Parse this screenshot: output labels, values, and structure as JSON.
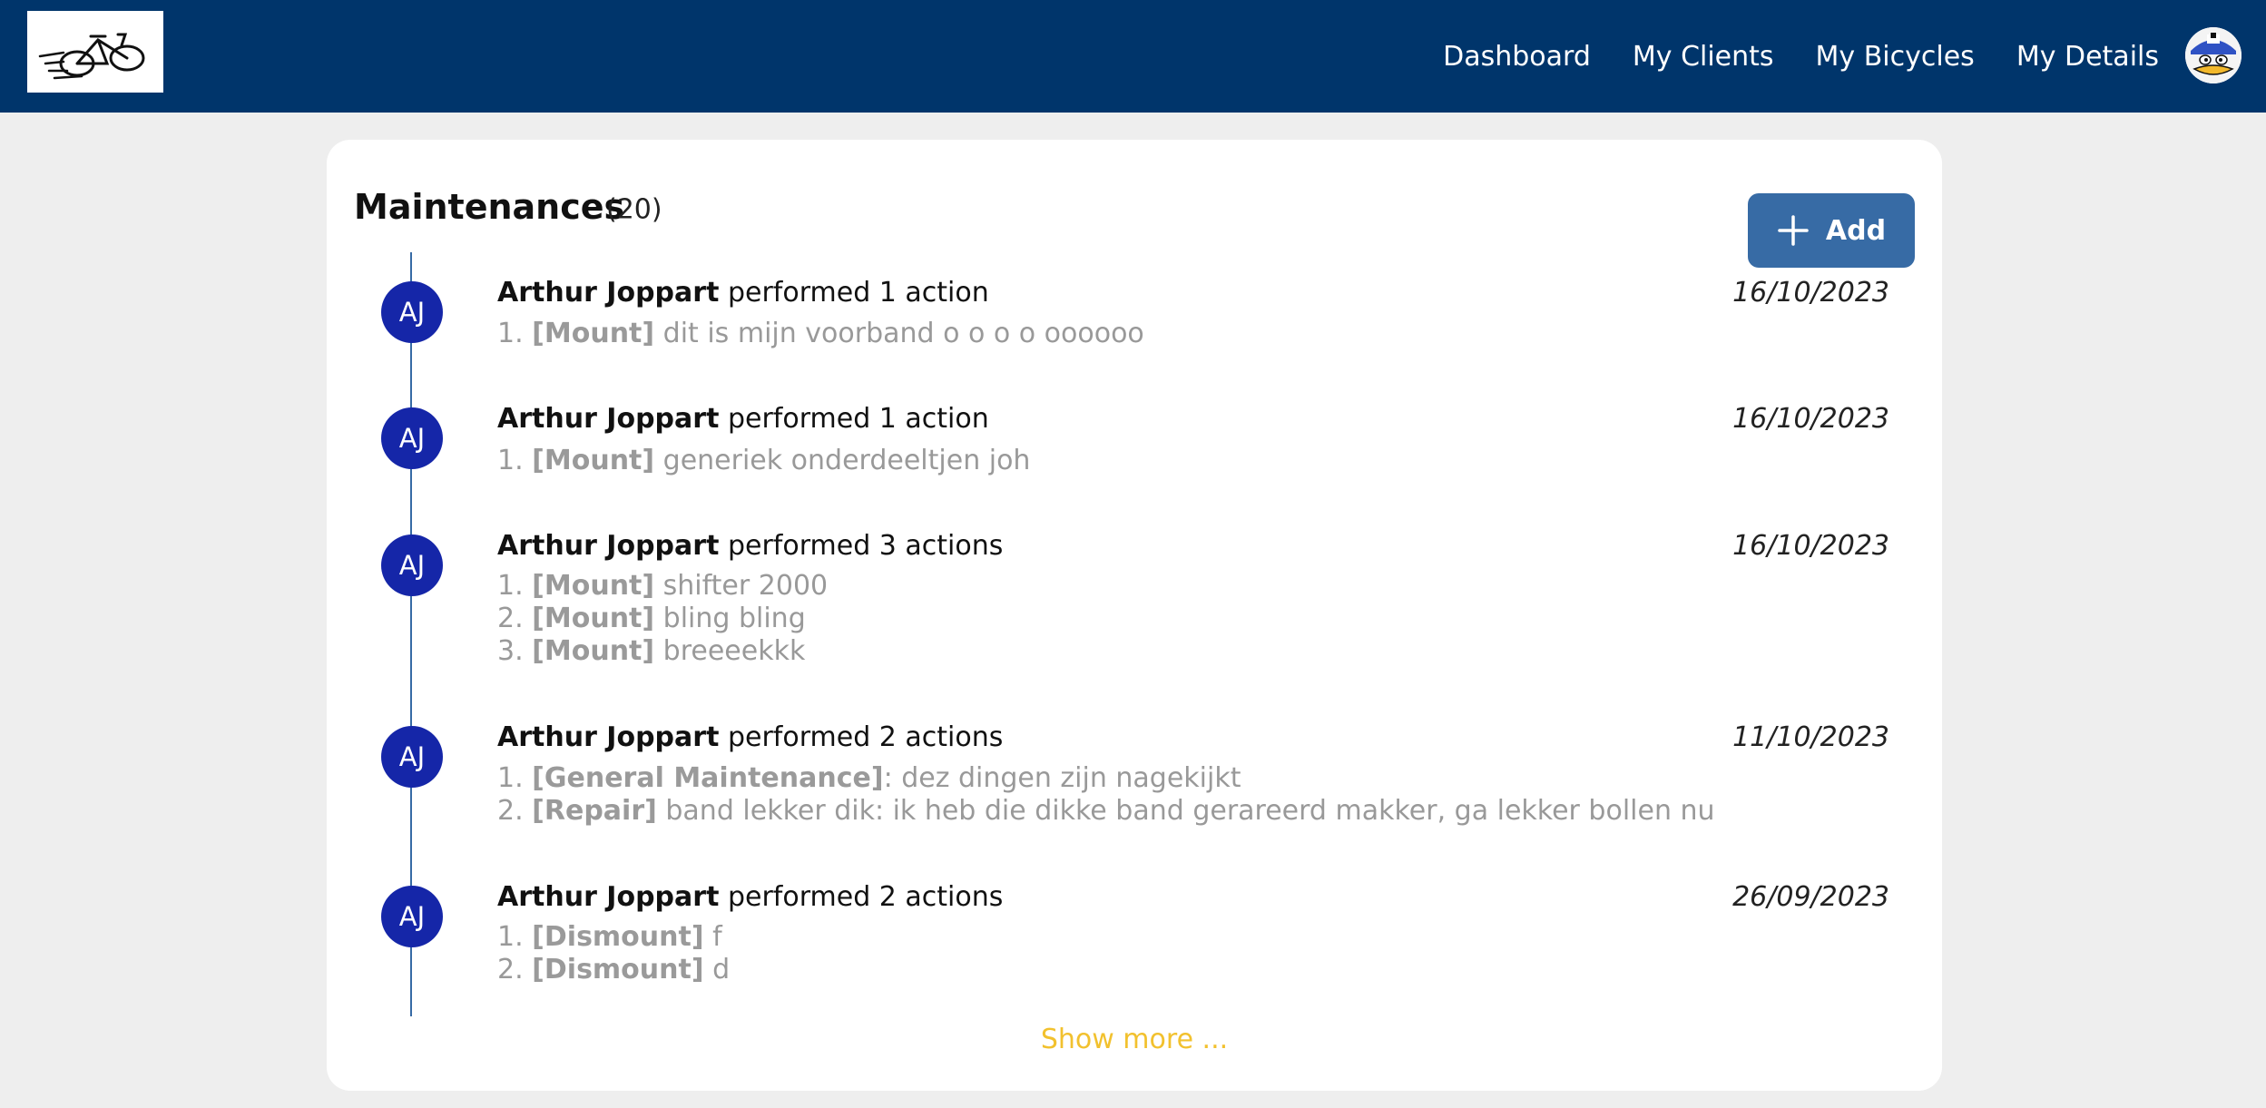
{
  "nav": {
    "items": [
      "Dashboard",
      "My Clients",
      "My Bicycles",
      "My Details"
    ]
  },
  "page": {
    "title": "Maintenances",
    "count": "(20)",
    "add_label": "Add",
    "show_more": "Show more ..."
  },
  "entries": [
    {
      "initials": "AJ",
      "name": "Arthur Joppart",
      "summary": " performed 1 action",
      "date": "16/10/2023",
      "actions": [
        {
          "num": "1.",
          "tag": "[Mount]",
          "text": " dit is mijn voorband o o o o oooooo"
        }
      ]
    },
    {
      "initials": "AJ",
      "name": "Arthur Joppart",
      "summary": " performed 1 action",
      "date": "16/10/2023",
      "actions": [
        {
          "num": "1.",
          "tag": "[Mount]",
          "text": " generiek onderdeeltjen joh"
        }
      ]
    },
    {
      "initials": "AJ",
      "name": "Arthur Joppart",
      "summary": " performed 3 actions",
      "date": "16/10/2023",
      "actions": [
        {
          "num": "1.",
          "tag": "[Mount]",
          "text": " shifter 2000"
        },
        {
          "num": "2.",
          "tag": "[Mount]",
          "text": " bling bling"
        },
        {
          "num": "3.",
          "tag": "[Mount]",
          "text": " breeeekkk"
        }
      ]
    },
    {
      "initials": "AJ",
      "name": "Arthur Joppart",
      "summary": " performed 2 actions",
      "date": "11/10/2023",
      "actions": [
        {
          "num": "1.",
          "tag": "[General Maintenance]",
          "text": ": dez dingen zijn nagekijkt"
        },
        {
          "num": "2.",
          "tag": "[Repair]",
          "text": " band lekker dik: ik heb die dikke band gerareerd makker, ga lekker bollen nu"
        }
      ]
    },
    {
      "initials": "AJ",
      "name": "Arthur Joppart",
      "summary": " performed 2 actions",
      "date": "26/09/2023",
      "actions": [
        {
          "num": "1.",
          "tag": "[Dismount]",
          "text": " f"
        },
        {
          "num": "2.",
          "tag": "[Dismount]",
          "text": " d"
        }
      ]
    }
  ],
  "icons": {
    "logo": "bicycle-logo-icon",
    "avatar": "duck-avatar-icon",
    "add": "plus-icon"
  },
  "colors": {
    "topbar": "#00356b",
    "accent_button": "#376ba5",
    "badge": "#1526a8",
    "show_more": "#f2c12e"
  }
}
